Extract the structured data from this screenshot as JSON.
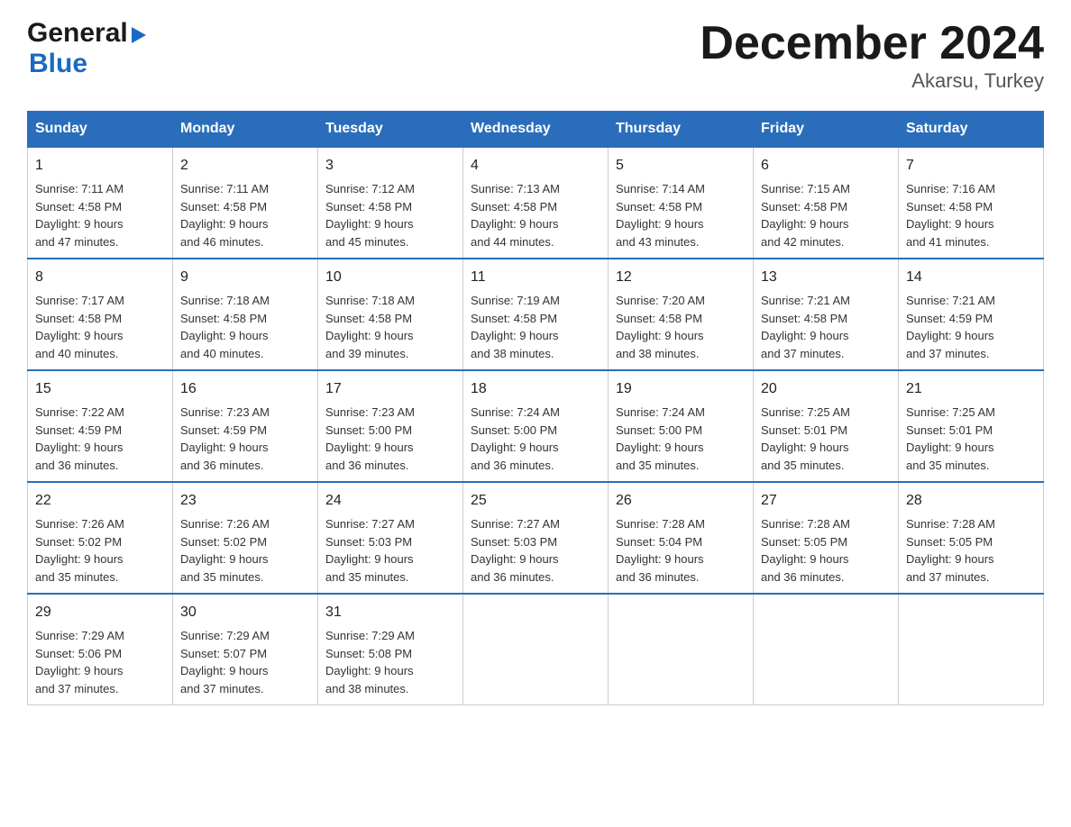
{
  "header": {
    "logo_general": "General",
    "logo_arrow": "▶",
    "logo_blue": "Blue",
    "month_title": "December 2024",
    "location": "Akarsu, Turkey"
  },
  "days_of_week": [
    "Sunday",
    "Monday",
    "Tuesday",
    "Wednesday",
    "Thursday",
    "Friday",
    "Saturday"
  ],
  "weeks": [
    [
      {
        "day": "1",
        "sunrise": "7:11 AM",
        "sunset": "4:58 PM",
        "daylight": "9 hours and 47 minutes."
      },
      {
        "day": "2",
        "sunrise": "7:11 AM",
        "sunset": "4:58 PM",
        "daylight": "9 hours and 46 minutes."
      },
      {
        "day": "3",
        "sunrise": "7:12 AM",
        "sunset": "4:58 PM",
        "daylight": "9 hours and 45 minutes."
      },
      {
        "day": "4",
        "sunrise": "7:13 AM",
        "sunset": "4:58 PM",
        "daylight": "9 hours and 44 minutes."
      },
      {
        "day": "5",
        "sunrise": "7:14 AM",
        "sunset": "4:58 PM",
        "daylight": "9 hours and 43 minutes."
      },
      {
        "day": "6",
        "sunrise": "7:15 AM",
        "sunset": "4:58 PM",
        "daylight": "9 hours and 42 minutes."
      },
      {
        "day": "7",
        "sunrise": "7:16 AM",
        "sunset": "4:58 PM",
        "daylight": "9 hours and 41 minutes."
      }
    ],
    [
      {
        "day": "8",
        "sunrise": "7:17 AM",
        "sunset": "4:58 PM",
        "daylight": "9 hours and 40 minutes."
      },
      {
        "day": "9",
        "sunrise": "7:18 AM",
        "sunset": "4:58 PM",
        "daylight": "9 hours and 40 minutes."
      },
      {
        "day": "10",
        "sunrise": "7:18 AM",
        "sunset": "4:58 PM",
        "daylight": "9 hours and 39 minutes."
      },
      {
        "day": "11",
        "sunrise": "7:19 AM",
        "sunset": "4:58 PM",
        "daylight": "9 hours and 38 minutes."
      },
      {
        "day": "12",
        "sunrise": "7:20 AM",
        "sunset": "4:58 PM",
        "daylight": "9 hours and 38 minutes."
      },
      {
        "day": "13",
        "sunrise": "7:21 AM",
        "sunset": "4:58 PM",
        "daylight": "9 hours and 37 minutes."
      },
      {
        "day": "14",
        "sunrise": "7:21 AM",
        "sunset": "4:59 PM",
        "daylight": "9 hours and 37 minutes."
      }
    ],
    [
      {
        "day": "15",
        "sunrise": "7:22 AM",
        "sunset": "4:59 PM",
        "daylight": "9 hours and 36 minutes."
      },
      {
        "day": "16",
        "sunrise": "7:23 AM",
        "sunset": "4:59 PM",
        "daylight": "9 hours and 36 minutes."
      },
      {
        "day": "17",
        "sunrise": "7:23 AM",
        "sunset": "5:00 PM",
        "daylight": "9 hours and 36 minutes."
      },
      {
        "day": "18",
        "sunrise": "7:24 AM",
        "sunset": "5:00 PM",
        "daylight": "9 hours and 36 minutes."
      },
      {
        "day": "19",
        "sunrise": "7:24 AM",
        "sunset": "5:00 PM",
        "daylight": "9 hours and 35 minutes."
      },
      {
        "day": "20",
        "sunrise": "7:25 AM",
        "sunset": "5:01 PM",
        "daylight": "9 hours and 35 minutes."
      },
      {
        "day": "21",
        "sunrise": "7:25 AM",
        "sunset": "5:01 PM",
        "daylight": "9 hours and 35 minutes."
      }
    ],
    [
      {
        "day": "22",
        "sunrise": "7:26 AM",
        "sunset": "5:02 PM",
        "daylight": "9 hours and 35 minutes."
      },
      {
        "day": "23",
        "sunrise": "7:26 AM",
        "sunset": "5:02 PM",
        "daylight": "9 hours and 35 minutes."
      },
      {
        "day": "24",
        "sunrise": "7:27 AM",
        "sunset": "5:03 PM",
        "daylight": "9 hours and 35 minutes."
      },
      {
        "day": "25",
        "sunrise": "7:27 AM",
        "sunset": "5:03 PM",
        "daylight": "9 hours and 36 minutes."
      },
      {
        "day": "26",
        "sunrise": "7:28 AM",
        "sunset": "5:04 PM",
        "daylight": "9 hours and 36 minutes."
      },
      {
        "day": "27",
        "sunrise": "7:28 AM",
        "sunset": "5:05 PM",
        "daylight": "9 hours and 36 minutes."
      },
      {
        "day": "28",
        "sunrise": "7:28 AM",
        "sunset": "5:05 PM",
        "daylight": "9 hours and 37 minutes."
      }
    ],
    [
      {
        "day": "29",
        "sunrise": "7:29 AM",
        "sunset": "5:06 PM",
        "daylight": "9 hours and 37 minutes."
      },
      {
        "day": "30",
        "sunrise": "7:29 AM",
        "sunset": "5:07 PM",
        "daylight": "9 hours and 37 minutes."
      },
      {
        "day": "31",
        "sunrise": "7:29 AM",
        "sunset": "5:08 PM",
        "daylight": "9 hours and 38 minutes."
      },
      null,
      null,
      null,
      null
    ]
  ],
  "labels": {
    "sunrise": "Sunrise:",
    "sunset": "Sunset:",
    "daylight": "Daylight:"
  }
}
